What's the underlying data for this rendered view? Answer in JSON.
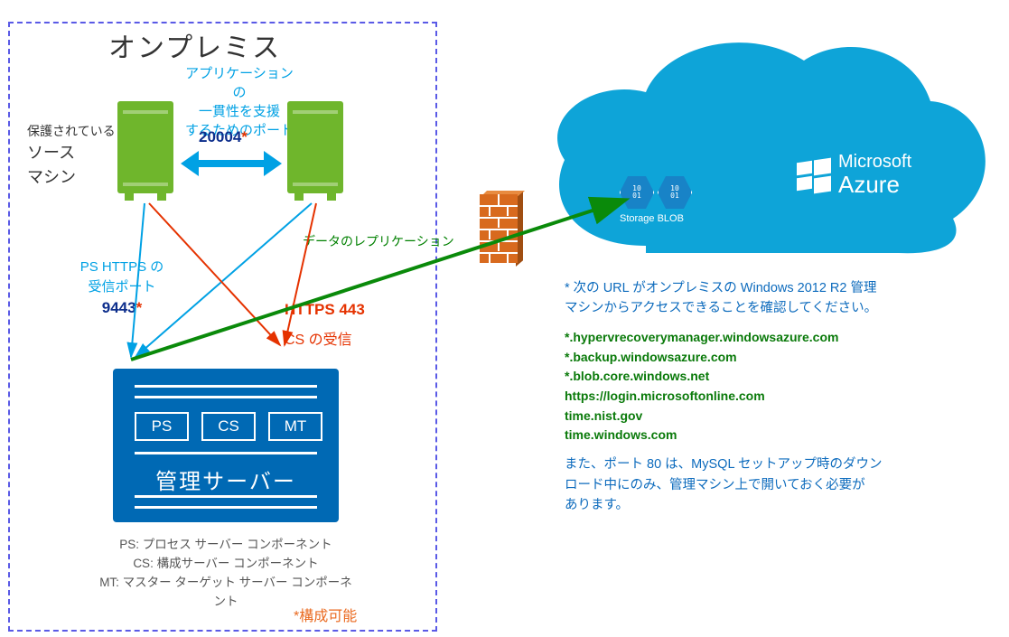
{
  "onprem": {
    "title": "オンプレミス",
    "app_port_line1": "アプリケーションの",
    "app_port_line2": "一貫性を支援",
    "app_port_line3": "するためのポート",
    "port_20004": "20004",
    "source_line1": "保護されている",
    "source_line2": "ソース",
    "source_line3": "マシン",
    "ps_https_line1": "PS HTTPS の",
    "ps_https_line2": "受信ポート",
    "port_9443": "9443",
    "https_443": "HTTPS 443",
    "cs_recv": "CS の受信",
    "rack": {
      "ps": "PS",
      "cs": "CS",
      "mt": "MT",
      "label": "管理サーバー"
    },
    "legend": {
      "ps": "PS: プロセス サーバー コンポーネント",
      "cs": "CS: 構成サーバー コンポーネント",
      "mt": "MT: マスター ターゲット サーバー コンポーネント"
    },
    "configurable": "*構成可能"
  },
  "replication_label": "データのレプリケーション",
  "azure": {
    "brand_line1": "Microsoft",
    "brand_line2": "Azure",
    "blob_label": "Storage BLOB",
    "hex_text": "10\n01"
  },
  "notes": {
    "intro_line1": "* 次の URL がオンプレミスの Windows 2012 R2 管理",
    "intro_line2": "マシンからアクセスできることを確認してください。",
    "urls": [
      "*.hypervrecoverymanager.windowsazure.com",
      "*.backup.windowsazure.com",
      "*.blob.core.windows.net",
      "https://login.microsoftonline.com",
      "time.nist.gov",
      "time.windows.com"
    ],
    "port80_line1": "また、ポート 80 は、MySQL セットアップ時のダウン",
    "port80_line2": "ロード中にのみ、管理マシン上で開いておく必要が",
    "port80_line3": "あります。"
  }
}
